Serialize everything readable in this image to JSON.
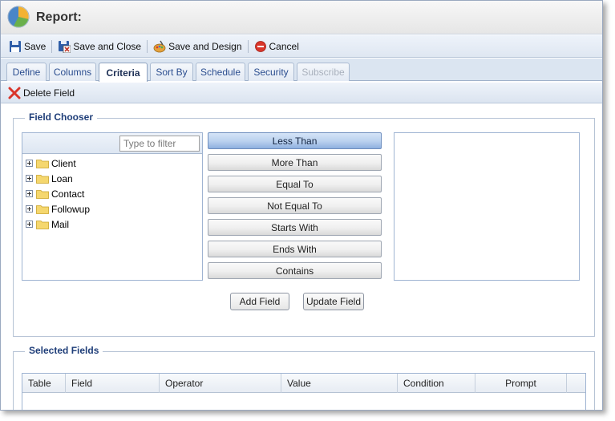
{
  "window": {
    "title": "Report:",
    "logo_icon": "report-pie-logo-icon"
  },
  "toolbar": {
    "items": [
      {
        "label": "Save",
        "icon": "floppy-disk-icon"
      },
      {
        "label": "Save and Close",
        "icon": "save-close-icon"
      },
      {
        "label": "Save and Design",
        "icon": "design-palette-icon"
      },
      {
        "label": "Cancel",
        "icon": "cancel-circle-icon"
      }
    ]
  },
  "tabs": [
    {
      "label": "Define",
      "state": "normal"
    },
    {
      "label": "Columns",
      "state": "normal"
    },
    {
      "label": "Criteria",
      "state": "active"
    },
    {
      "label": "Sort By",
      "state": "normal"
    },
    {
      "label": "Schedule",
      "state": "normal"
    },
    {
      "label": "Security",
      "state": "normal"
    },
    {
      "label": "Subscribe",
      "state": "disabled"
    }
  ],
  "subtoolbar": {
    "delete_label": "Delete Field",
    "delete_icon": "red-x-icon"
  },
  "field_chooser": {
    "legend": "Field Chooser",
    "filter_placeholder": "Type to filter",
    "tree_items": [
      "Client",
      "Loan",
      "Contact",
      "Followup",
      "Mail"
    ],
    "operators": [
      "Less Than",
      "More Than",
      "Equal To",
      "Not Equal To",
      "Starts With",
      "Ends With",
      "Contains"
    ],
    "active_operator": "Less Than",
    "add_label": "Add Field",
    "update_label": "Update Field"
  },
  "selected_fields": {
    "legend": "Selected Fields",
    "columns": [
      "Table",
      "Field",
      "Operator",
      "Value",
      "Condition",
      "Prompt"
    ]
  },
  "colors": {
    "accent": "#1f3e79",
    "tab_text": "#2a4d8f",
    "active_operator": "#b9d0ee",
    "cancel_red": "#d9362b"
  }
}
